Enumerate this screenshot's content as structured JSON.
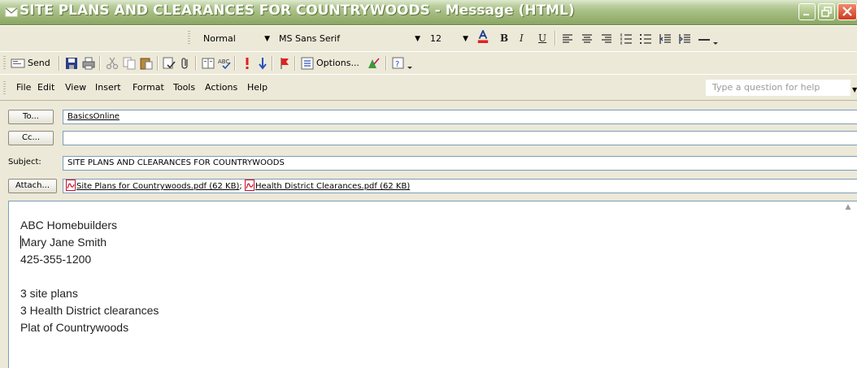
{
  "window": {
    "title": "SITE PLANS AND CLEARANCES FOR COUNTRYWOODS - Message (HTML)",
    "icon": "envelope-icon",
    "controls": [
      "minimize-icon",
      "maximize-icon",
      "close-icon"
    ]
  },
  "format_toolbar": {
    "style_value": "Normal",
    "font_value": "MS Sans Serif",
    "size_value": "12",
    "buttons": [
      "font-color-icon",
      "bold-icon",
      "italic-icon",
      "underline-icon",
      "align-left-icon",
      "align-center-icon",
      "align-right-icon",
      "numbering-icon",
      "bullets-icon",
      "decrease-indent-icon",
      "increase-indent-icon",
      "horizontal-line-icon"
    ],
    "bold_label": "B",
    "italic_label": "I",
    "underline_label": "U"
  },
  "standard_toolbar": {
    "send_label": "Send",
    "options_label": "Options...",
    "icons": [
      "send-icon",
      "save-icon",
      "print-icon",
      "cut-icon",
      "copy-icon",
      "paste-icon",
      "check-names-icon",
      "attach-icon",
      "address-book-icon",
      "spelling-icon",
      "high-importance-icon",
      "low-importance-icon",
      "flag-icon",
      "options-icon",
      "signature-icon",
      "help-icon"
    ]
  },
  "menu": {
    "items": [
      "File",
      "Edit",
      "View",
      "Insert",
      "Format",
      "Tools",
      "Actions",
      "Help"
    ],
    "help_placeholder": "Type a question for help"
  },
  "header": {
    "to_label": "To...",
    "to_value": "BasicsOnline",
    "cc_label": "Cc...",
    "cc_value": "",
    "subject_label": "Subject:",
    "subject_value": "SITE PLANS AND CLEARANCES FOR COUNTRYWOODS",
    "attach_label": "Attach...",
    "attachments": [
      {
        "name": "Site Plans for Countrywoods.pdf (62 KB)",
        "icon": "pdf-icon"
      },
      {
        "name": "Health District Clearances.pdf (62 KB)",
        "icon": "pdf-icon"
      }
    ],
    "attachment_separator": ";"
  },
  "body": {
    "lines": [
      "ABC Homebuilders",
      "Mary Jane Smith",
      "425-355-1200",
      "",
      "3 site plans",
      "3 Health District clearances",
      "Plat of Countrywoods"
    ]
  },
  "colors": {
    "titlebar_green": "#96b06f",
    "toolbar_bg": "#ece9d8",
    "field_border": "#7f9db9",
    "pdf_red": "#c8102e"
  }
}
